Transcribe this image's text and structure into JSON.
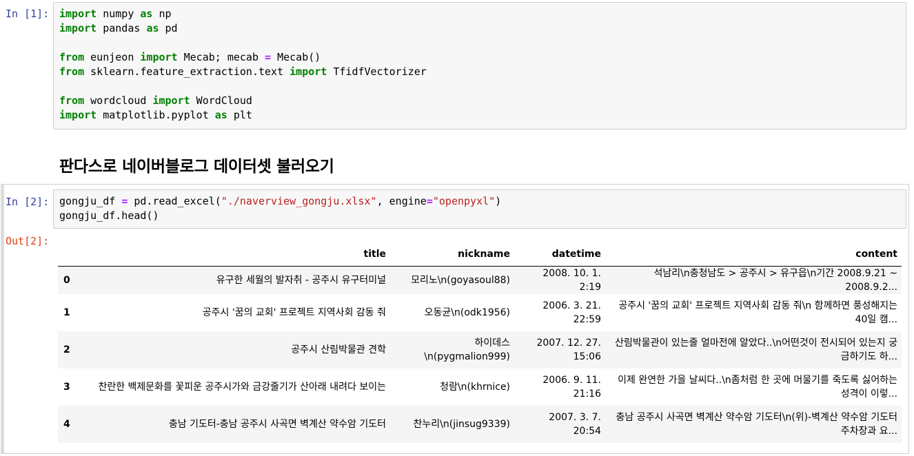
{
  "cell1": {
    "prompt": "In [1]:",
    "lines": [
      [
        {
          "t": "import",
          "c": "kw"
        },
        {
          "t": " numpy "
        },
        {
          "t": "as",
          "c": "kw"
        },
        {
          "t": " np"
        }
      ],
      [
        {
          "t": "import",
          "c": "kw"
        },
        {
          "t": " pandas "
        },
        {
          "t": "as",
          "c": "kw"
        },
        {
          "t": " pd"
        }
      ],
      [],
      [
        {
          "t": "from",
          "c": "kw"
        },
        {
          "t": " eunjeon "
        },
        {
          "t": "import",
          "c": "kw"
        },
        {
          "t": " Mecab; mecab "
        },
        {
          "t": "=",
          "c": "op"
        },
        {
          "t": " Mecab()"
        }
      ],
      [
        {
          "t": "from",
          "c": "kw"
        },
        {
          "t": " sklearn.feature_extraction.text "
        },
        {
          "t": "import",
          "c": "kw"
        },
        {
          "t": " TfidfVectorizer"
        }
      ],
      [],
      [
        {
          "t": "from",
          "c": "kw"
        },
        {
          "t": " wordcloud "
        },
        {
          "t": "import",
          "c": "kw"
        },
        {
          "t": " WordCloud"
        }
      ],
      [
        {
          "t": "import",
          "c": "kw"
        },
        {
          "t": " matplotlib.pyplot "
        },
        {
          "t": "as",
          "c": "kw"
        },
        {
          "t": " plt"
        }
      ]
    ]
  },
  "markdown": {
    "heading": "판다스로 네이버블로그 데이터셋 불러오기"
  },
  "cell2": {
    "prompt": "In [2]:",
    "out_prompt": "Out[2]:",
    "lines": [
      [
        {
          "t": "gongju_df "
        },
        {
          "t": "=",
          "c": "op"
        },
        {
          "t": " pd.read_excel("
        },
        {
          "t": "\"./naverview_gongju.xlsx\"",
          "c": "str"
        },
        {
          "t": ", engine"
        },
        {
          "t": "=",
          "c": "op"
        },
        {
          "t": "\"openpyxl\"",
          "c": "str"
        },
        {
          "t": ")"
        }
      ],
      [
        {
          "t": "gongju_df.head()"
        }
      ]
    ]
  },
  "table": {
    "columns": [
      "",
      "title",
      "nickname",
      "datetime",
      "content"
    ],
    "rows": [
      {
        "index": "0",
        "title": "유구한 세월의 발자취 - 공주시 유구터미널",
        "nickname": "모리노\\n(goyasoul88)",
        "datetime": "2008. 10. 1. 2:19",
        "content": "석남리\\n충청남도 > 공주시 > 유구읍\\n기간 2008.9.21 ~ 2008.9.2..."
      },
      {
        "index": "1",
        "title": "공주시 '꿈의 교회' 프로젝트 지역사회 감동 줘",
        "nickname": "오동균\\n(odk1956)",
        "datetime": "2006. 3. 21. 22:59",
        "content": "공주시 '꿈의 교회' 프로젝트 지역사회 감동 줘\\n 함께하면 풍성해지는 40일 캠..."
      },
      {
        "index": "2",
        "title": "공주시 산림박물관 견학",
        "nickname": "하이데스\\n(pygmalion999)",
        "datetime": "2007. 12. 27. 15:06",
        "content": "산림박물관이 있는줄 얼마전에 알았다..\\n어떤것이 전시되어 있는지 궁금하기도 하..."
      },
      {
        "index": "3",
        "title": "찬란한 백제문화를 꽃피운 공주시가와 금강줄기가 산아래 내려다 보이는",
        "nickname": "청람\\n(khrnice)",
        "datetime": "2006. 9. 11. 21:16",
        "content": "이제 완연한 가을 날씨다..\\n좀처럼 한 곳에 머물기를 죽도록 싫어하는 성격이 이렇..."
      },
      {
        "index": "4",
        "title": "충남 기도터-충남 공주시 사곡면 벽계산 약수암 기도터",
        "nickname": "찬누리\\n(jinsug9339)",
        "datetime": "2007. 3. 7. 20:54",
        "content": "충남 공주시 사곡면 벽계산 약수암 기도터\\n(위)-벽계산 약수암 기도터 주차장과 요..."
      }
    ]
  }
}
